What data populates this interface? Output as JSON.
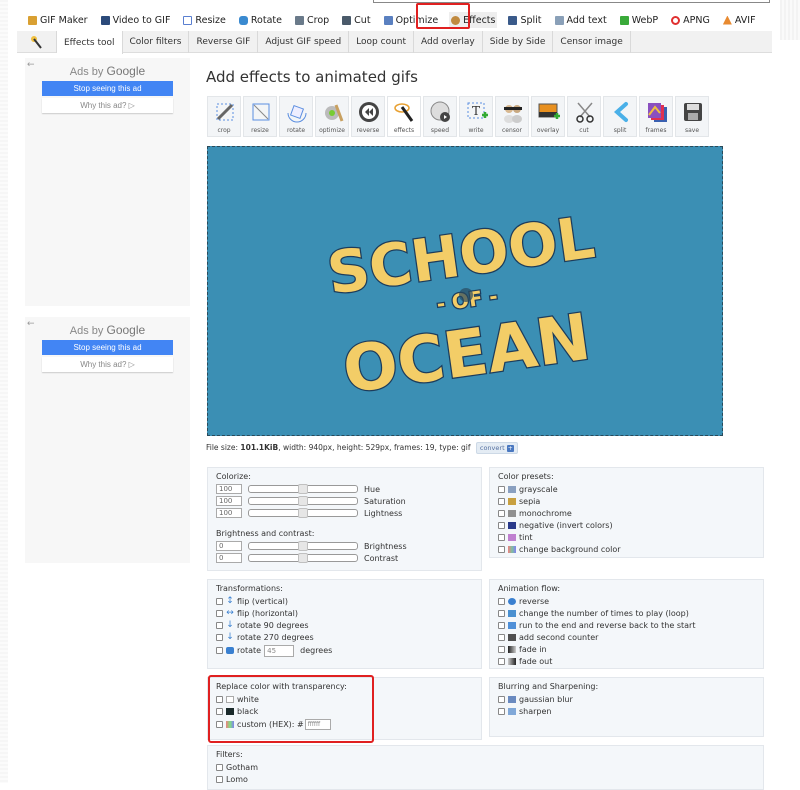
{
  "main_nav": [
    {
      "label": "GIF Maker",
      "icon": "gif-maker-icon",
      "color": "#d9a032"
    },
    {
      "label": "Video to GIF",
      "icon": "film-icon",
      "color": "#2b4a7a"
    },
    {
      "label": "Resize",
      "icon": "resize-icon",
      "color": "#5a7fd0"
    },
    {
      "label": "Rotate",
      "icon": "rotate-icon",
      "color": "#3a8ad0"
    },
    {
      "label": "Crop",
      "icon": "crop-icon",
      "color": "#6a7a8a"
    },
    {
      "label": "Cut",
      "icon": "cut-icon",
      "color": "#4a5a6a"
    },
    {
      "label": "Optimize",
      "icon": "optimize-icon",
      "color": "#5a80c0"
    },
    {
      "label": "Effects",
      "icon": "effects-icon",
      "color": "#c08a40",
      "active": true
    },
    {
      "label": "Split",
      "icon": "split-icon",
      "color": "#3a5a8a"
    },
    {
      "label": "Add text",
      "icon": "add-text-icon",
      "color": "#8aa0b8"
    },
    {
      "label": "WebP",
      "icon": "webp-icon",
      "color": "#3aaa3a"
    },
    {
      "label": "APNG",
      "icon": "apng-icon",
      "color": "#e03030"
    },
    {
      "label": "AVIF",
      "icon": "avif-icon",
      "color": "#e88a30"
    }
  ],
  "sub_nav": [
    {
      "label": "Effects tool",
      "active": true
    },
    {
      "label": "Color filters"
    },
    {
      "label": "Reverse GIF"
    },
    {
      "label": "Adjust GIF speed"
    },
    {
      "label": "Loop count"
    },
    {
      "label": "Add overlay"
    },
    {
      "label": "Side by Side"
    },
    {
      "label": "Censor image"
    }
  ],
  "ads": [
    {
      "back": "←",
      "ads_by": "Ads by",
      "brand": "Google",
      "stop": "Stop seeing this ad",
      "why": "Why this ad? ▷"
    },
    {
      "back": "←",
      "ads_by": "Ads by",
      "brand": "Google",
      "stop": "Stop seeing this ad",
      "why": "Why this ad? ▷"
    }
  ],
  "page_title": "Add effects to animated gifs",
  "tools": [
    {
      "label": "crop",
      "icon": "crop-tool-icon"
    },
    {
      "label": "resize",
      "icon": "resize-tool-icon"
    },
    {
      "label": "rotate",
      "icon": "rotate-tool-icon"
    },
    {
      "label": "optimize",
      "icon": "optimize-tool-icon"
    },
    {
      "label": "reverse",
      "icon": "reverse-tool-icon"
    },
    {
      "label": "effects",
      "icon": "effects-tool-icon",
      "active": true
    },
    {
      "label": "speed",
      "icon": "speed-tool-icon"
    },
    {
      "label": "write",
      "icon": "write-tool-icon"
    },
    {
      "label": "censor",
      "icon": "censor-tool-icon"
    },
    {
      "label": "overlay",
      "icon": "overlay-tool-icon"
    },
    {
      "label": "cut",
      "icon": "cut-tool-icon"
    },
    {
      "label": "split",
      "icon": "split-tool-icon"
    },
    {
      "label": "frames",
      "icon": "frames-tool-icon"
    },
    {
      "label": "save",
      "icon": "save-tool-icon"
    }
  ],
  "gif": {
    "line1": "SCHOOL",
    "line2": "- OF -",
    "line3": "OCEAN",
    "bg_color": "#3b8fb4",
    "text_color": "#f3cd67"
  },
  "file_info": {
    "prefix": "File size: ",
    "size": "101.1KiB",
    "rest": ", width: 940px, height: 529px, frames: 19, type: gif",
    "convert": "convert"
  },
  "colorize": {
    "title": "Colorize:",
    "rows": [
      {
        "value": "100",
        "label": "Hue",
        "level": 0.5
      },
      {
        "value": "100",
        "label": "Saturation",
        "level": 0.5
      },
      {
        "value": "100",
        "label": "Lightness",
        "level": 0.5
      }
    ],
    "bc_title": "Brightness and contrast:",
    "bc_rows": [
      {
        "value": "0",
        "label": "Brightness",
        "level": 0.5
      },
      {
        "value": "0",
        "label": "Contrast",
        "level": 0.5
      }
    ]
  },
  "color_presets": {
    "title": "Color presets:",
    "items": [
      {
        "label": "grayscale",
        "icon": "grayscale-icon",
        "color": "#8aa0c0"
      },
      {
        "label": "sepia",
        "icon": "sepia-icon",
        "color": "#c8a040"
      },
      {
        "label": "monochrome",
        "icon": "monochrome-icon",
        "color": "#909090"
      },
      {
        "label": "negative (invert colors)",
        "icon": "negative-icon",
        "color": "#2a3a8a"
      },
      {
        "label": "tint",
        "icon": "tint-icon",
        "color": "#c080d0"
      },
      {
        "label": "change background color",
        "icon": "background-color-icon",
        "color": "#80c0a0"
      }
    ]
  },
  "transformations": {
    "title": "Transformations:",
    "items": [
      {
        "label": "flip (vertical)",
        "icon": "flip-vertical-icon"
      },
      {
        "label": "flip (horizontal)",
        "icon": "flip-horizontal-icon"
      },
      {
        "label": "rotate 90 degrees",
        "icon": "rotate-90-icon"
      },
      {
        "label": "rotate 270 degrees",
        "icon": "rotate-270-icon"
      }
    ],
    "rotate_custom": {
      "label": "rotate",
      "value": "45",
      "suffix": "degrees"
    }
  },
  "animation_flow": {
    "title": "Animation flow:",
    "items": [
      {
        "label": "reverse",
        "icon": "reverse-icon",
        "color": "#3a80d0"
      },
      {
        "label": "change the number of times to play (loop)",
        "icon": "loop-icon",
        "color": "#4a90d0"
      },
      {
        "label": "run to the end and reverse back to the start",
        "icon": "bounce-icon",
        "color": "#5090d8"
      },
      {
        "label": "add second counter",
        "icon": "counter-icon",
        "color": "#505050"
      },
      {
        "label": "fade in",
        "icon": "fade-in-icon",
        "color": "#3a4a6a"
      },
      {
        "label": "fade out",
        "icon": "fade-out-icon",
        "color": "#3a4a6a"
      }
    ]
  },
  "replace_color": {
    "title": "Replace color with transparency:",
    "items": [
      {
        "label": "white",
        "icon": "white-swatch-icon",
        "color": "#ffffff"
      },
      {
        "label": "black",
        "icon": "black-swatch-icon",
        "color": "#1a2a2a"
      }
    ],
    "custom_label": "custom (HEX): #",
    "custom_value": "ffffff"
  },
  "blurring": {
    "title": "Blurring and Sharpening:",
    "items": [
      {
        "label": "gaussian blur",
        "icon": "blur-icon",
        "color": "#6a8ac0"
      },
      {
        "label": "sharpen",
        "icon": "sharpen-icon",
        "color": "#80a8d8"
      }
    ]
  },
  "filters": {
    "title": "Filters:",
    "items": [
      {
        "label": "Gotham"
      },
      {
        "label": "Lomo"
      }
    ]
  }
}
